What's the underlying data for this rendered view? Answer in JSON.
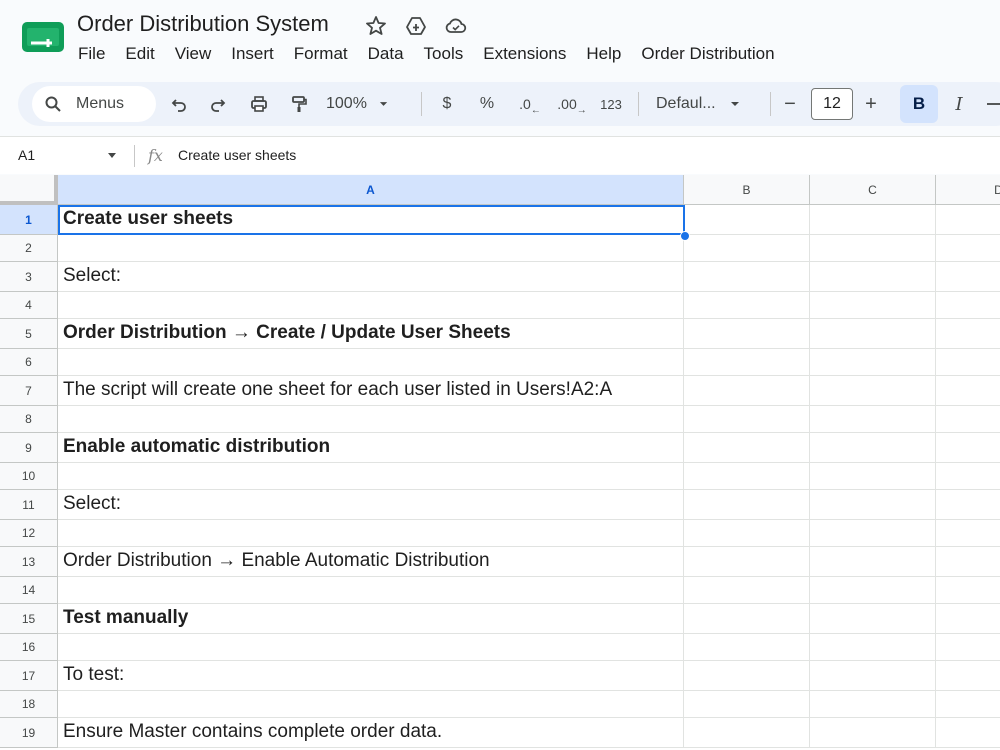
{
  "app": {
    "title": "Order Distribution System",
    "menus": [
      "File",
      "Edit",
      "View",
      "Insert",
      "Format",
      "Data",
      "Tools",
      "Extensions",
      "Help",
      "Order Distribution"
    ]
  },
  "toolbar": {
    "search_label": "Menus",
    "zoom": "100%",
    "currency": "$",
    "percent": "%",
    "decrease_decimal": ".0",
    "increase_decimal": ".00",
    "number_format": "123",
    "font": "Defaul...",
    "minus": "−",
    "font_size": "12",
    "plus": "+",
    "bold": "B",
    "italic": "I"
  },
  "formula_bar": {
    "cell_ref": "A1",
    "fx": "fx",
    "content": "Create user sheets"
  },
  "grid": {
    "columns": [
      "A",
      "B",
      "C",
      "D"
    ],
    "rows": [
      {
        "num": "1",
        "text": "Create user sheets",
        "bold": true
      },
      {
        "num": "2",
        "text": "",
        "bold": false
      },
      {
        "num": "3",
        "text": "Select:",
        "bold": false
      },
      {
        "num": "4",
        "text": "",
        "bold": false
      },
      {
        "num": "5",
        "text": "Order Distribution → Create / Update User Sheets",
        "bold": true
      },
      {
        "num": "6",
        "text": "",
        "bold": false
      },
      {
        "num": "7",
        "text": "The script will create one sheet for each user listed in Users!A2:A",
        "bold": false
      },
      {
        "num": "8",
        "text": "",
        "bold": false
      },
      {
        "num": "9",
        "text": "Enable automatic distribution",
        "bold": true
      },
      {
        "num": "10",
        "text": "",
        "bold": false
      },
      {
        "num": "11",
        "text": "Select:",
        "bold": false
      },
      {
        "num": "12",
        "text": "",
        "bold": false
      },
      {
        "num": "13",
        "text": "Order Distribution → Enable Automatic Distribution",
        "bold": false
      },
      {
        "num": "14",
        "text": "",
        "bold": false
      },
      {
        "num": "15",
        "text": "Test manually",
        "bold": true
      },
      {
        "num": "16",
        "text": "",
        "bold": false
      },
      {
        "num": "17",
        "text": "To test:",
        "bold": false
      },
      {
        "num": "18",
        "text": "",
        "bold": false
      },
      {
        "num": "19",
        "text": "Ensure Master contains complete order data.",
        "bold": false
      }
    ]
  },
  "colors": {
    "accent": "#1a73e8",
    "selected_header": "#d3e3fd",
    "toolbar_bg": "#edf2fa",
    "logo_green": "#0f9d58"
  }
}
